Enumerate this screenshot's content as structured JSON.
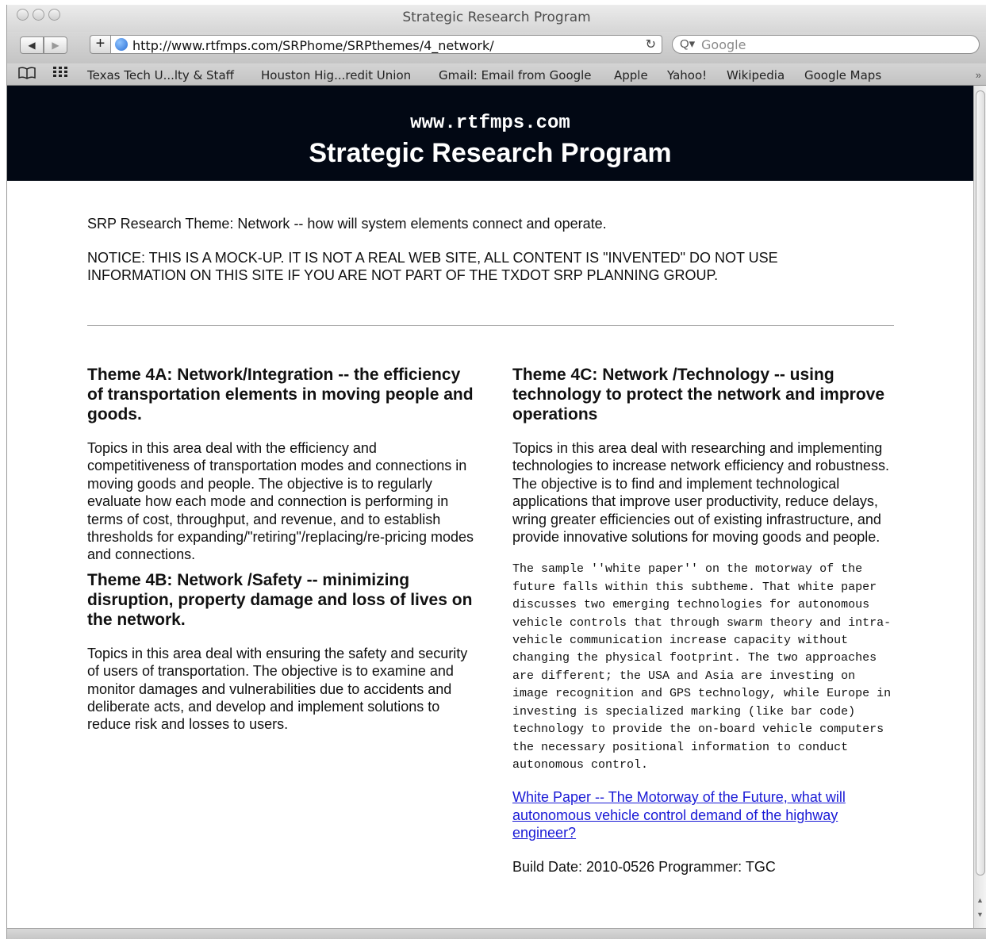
{
  "window": {
    "title": "Strategic Research Program"
  },
  "toolbar": {
    "back": "◀",
    "forward": "▶",
    "add": "+",
    "url": "http://www.rtfmps.com/SRPhome/SRPthemes/4_network/",
    "reload": "↻",
    "search_icon": "Q▾",
    "search_placeholder": "Google"
  },
  "bookmarks": {
    "items": [
      "Texas Tech U...lty & Staff",
      "Houston Hig...redit Union",
      "Gmail: Email from Google",
      "Apple",
      "Yahoo!",
      "Wikipedia",
      "Google Maps"
    ],
    "more": "»"
  },
  "banner": {
    "site": "www.rtfmps.com",
    "title": "Strategic Research Program"
  },
  "intro": "SRP Research Theme: Network -- how will system elements connect and operate.",
  "notice": "NOTICE: THIS IS A MOCK-UP. IT IS NOT A REAL WEB SITE, ALL CONTENT IS \"INVENTED\" DO NOT USE INFORMATION ON THIS SITE IF YOU ARE NOT PART OF THE TXDOT SRP PLANNING GROUP.",
  "theme4a": {
    "heading": "Theme 4A: Network/Integration -- the efficiency of transportation elements in moving people and goods.",
    "body": "Topics in this area deal with the efficiency and competitiveness of transportation modes and connections in moving goods and people. The objective is to regularly evaluate how each mode and connection is performing in terms of cost, throughput, and revenue, and to establish thresholds for expanding/\"retiring\"/replacing/re-pricing modes and connections."
  },
  "theme4b": {
    "heading": "Theme 4B: Network /Safety -- minimizing disruption, property damage and loss of lives on the network.",
    "body": "Topics in this area deal with ensuring the safety and security of users of transportation. The objective is to examine and monitor damages and vulnerabilities due to accidents and deliberate acts, and develop and implement solutions to reduce risk and losses to users."
  },
  "theme4c": {
    "heading": "Theme 4C: Network /Technology -- using technology to protect the network and improve operations",
    "body": "Topics in this area deal with researching and implementing technologies to increase network efficiency and robustness. The objective is to find and implement technological applications that improve user productivity, reduce delays, wring greater efficiencies out of existing infrastructure, and provide innovative solutions for moving goods and people.",
    "sample": "The sample ''white paper'' on the motorway of the future falls within this subtheme. That white paper discusses two emerging technologies for autonomous vehicle controls that through swarm theory and intra-vehicle communication increase capacity without changing the physical footprint. The two approaches are different; the USA and Asia are investing on image recognition and GPS technology, while Europe in investing is specialized marking (like bar code) technology to provide the on-board vehicle computers the necessary positional information to conduct autonomous control.",
    "link": "White Paper -- The Motorway of the Future, what will autonomous vehicle control demand of the highway engineer?"
  },
  "build": "Build Date: 2010-0526 Programmer: TGC"
}
